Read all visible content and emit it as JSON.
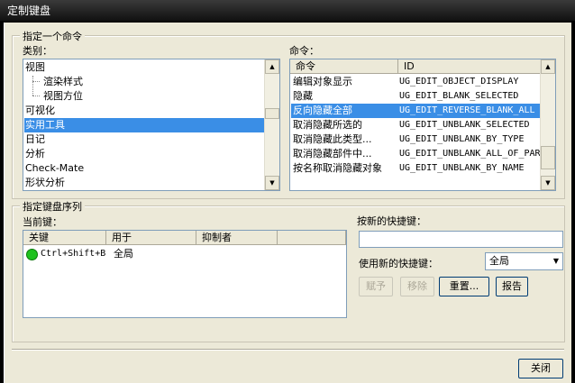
{
  "window": {
    "title": "定制键盘"
  },
  "specify_command": {
    "legend": "指定一个命令",
    "category_label": "类别：",
    "categories": [
      {
        "label": "视图"
      },
      {
        "label": "渲染样式"
      },
      {
        "label": "视图方位"
      },
      {
        "label": "可视化"
      },
      {
        "label": "实用工具"
      },
      {
        "label": "日记"
      },
      {
        "label": "分析"
      },
      {
        "label": "Check-Mate"
      },
      {
        "label": "形状分析"
      }
    ],
    "command_label": "命令：",
    "command_columns": {
      "command": "命令",
      "id": "ID"
    },
    "commands": [
      {
        "name": "编辑对象显示",
        "id": "UG_EDIT_OBJECT_DISPLAY"
      },
      {
        "name": "隐藏",
        "id": "UG_EDIT_BLANK_SELECTED"
      },
      {
        "name": "反向隐藏全部",
        "id": "UG_EDIT_REVERSE_BLANK_ALL"
      },
      {
        "name": "取消隐藏所选的",
        "id": "UG_EDIT_UNBLANK_SELECTED"
      },
      {
        "name": "取消隐藏此类型...",
        "id": "UG_EDIT_UNBLANK_BY_TYPE"
      },
      {
        "name": "取消隐藏部件中...",
        "id": "UG_EDIT_UNBLANK_ALL_OF_PART"
      },
      {
        "name": "按名称取消隐藏对象",
        "id": "UG_EDIT_UNBLANK_BY_NAME"
      }
    ]
  },
  "shortcut_sequence": {
    "legend": "指定键盘序列",
    "current_keys_label": "当前键：",
    "columns": {
      "key": "关键",
      "used_in": "用于",
      "suppressor": "抑制者"
    },
    "rows": [
      {
        "key": "Ctrl+Shift+B",
        "used_in": "全局",
        "suppressor": ""
      }
    ],
    "new_shortcut_label": "按新的快捷键：",
    "new_shortcut_value": "",
    "use_new_label": "使用新的快捷键：",
    "use_new_selected": "全局",
    "buttons": {
      "assign": "赋予",
      "remove": "移除",
      "reset": "重置...",
      "report": "报告"
    }
  },
  "footer": {
    "close_label": "关闭"
  },
  "colors": {
    "selection": "#3a8ee6",
    "status_ok": "#1fc21f",
    "titlebar": "#1a1a1a"
  }
}
